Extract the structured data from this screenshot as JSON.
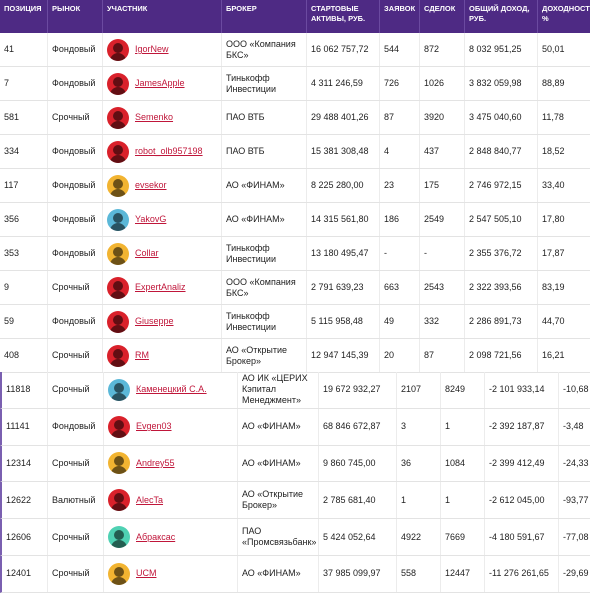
{
  "header": {
    "position": "ПОЗИЦИЯ",
    "market": "РЫНОК",
    "participant": "УЧАСТНИК",
    "broker": "БРОКЕР",
    "assets": "СТАРТОВЫЕ АКТИВЫ, РУБ.",
    "orders": "ЗАЯВОК",
    "deals": "СДЕЛОК",
    "income": "ОБЩИЙ ДОХОД, РУБ.",
    "yield": "ДОХОДНОСТЬ, %"
  },
  "top_rows": [
    {
      "pos": "41",
      "market": "Фондовый",
      "name": "IgorNew",
      "broker": "ООО «Компания БКС»",
      "assets": "16 062 757,72",
      "orders": "544",
      "deals": "872",
      "income": "8 032 951,25",
      "yield": "50,01",
      "avatar_color": "#d9212b"
    },
    {
      "pos": "7",
      "market": "Фондовый",
      "name": "JamesApple",
      "broker": "Тинькофф Инвестиции",
      "assets": "4 311 246,59",
      "orders": "726",
      "deals": "1026",
      "income": "3 832 059,98",
      "yield": "88,89",
      "avatar_color": "#d9212b"
    },
    {
      "pos": "581",
      "market": "Срочный",
      "name": "Semenko",
      "broker": "ПАО ВТБ",
      "assets": "29 488 401,26",
      "orders": "87",
      "deals": "3920",
      "income": "3 475 040,60",
      "yield": "11,78",
      "avatar_color": "#d9212b"
    },
    {
      "pos": "334",
      "market": "Фондовый",
      "name": "robot_olb957198",
      "broker": "ПАО ВТБ",
      "assets": "15 381 308,48",
      "orders": "4",
      "deals": "437",
      "income": "2 848 840,77",
      "yield": "18,52",
      "avatar_color": "#d9212b"
    },
    {
      "pos": "117",
      "market": "Фондовый",
      "name": "evsekor",
      "broker": "АО «ФИНАМ»",
      "assets": "8 225 280,00",
      "orders": "23",
      "deals": "175",
      "income": "2 746 972,15",
      "yield": "33,40",
      "avatar_color": "#f2b431"
    },
    {
      "pos": "356",
      "market": "Фондовый",
      "name": "YakovG",
      "broker": "АО «ФИНАМ»",
      "assets": "14 315 561,80",
      "orders": "186",
      "deals": "2549",
      "income": "2 547 505,10",
      "yield": "17,80",
      "avatar_color": "#5bb8d8"
    },
    {
      "pos": "353",
      "market": "Фондовый",
      "name": "Collar",
      "broker": "Тинькофф Инвестиции",
      "assets": "13 180 495,47",
      "orders": "-",
      "deals": "-",
      "income": "2 355 376,72",
      "yield": "17,87",
      "avatar_color": "#f2b431"
    },
    {
      "pos": "9",
      "market": "Срочный",
      "name": "ExpertAnaliz",
      "broker": "ООО «Компания БКС»",
      "assets": "2 791 639,23",
      "orders": "663",
      "deals": "2543",
      "income": "2 322 393,56",
      "yield": "83,19",
      "avatar_color": "#d9212b"
    },
    {
      "pos": "59",
      "market": "Фондовый",
      "name": "Giuseppe",
      "broker": "Тинькофф Инвестиции",
      "assets": "5 115 958,48",
      "orders": "49",
      "deals": "332",
      "income": "2 286 891,73",
      "yield": "44,70",
      "avatar_color": "#d9212b"
    },
    {
      "pos": "408",
      "market": "Срочный",
      "name": "RM",
      "broker": "АО «Открытие Брокер»",
      "assets": "12 947 145,39",
      "orders": "20",
      "deals": "87",
      "income": "2 098 721,56",
      "yield": "16,21",
      "avatar_color": "#d9212b"
    }
  ],
  "bottom_rows": [
    {
      "pos": "11818",
      "market": "Срочный",
      "name": "Каменецкий С.А.",
      "broker": "АО ИК «ЦЕРИХ Кэпитал Менеджмент»",
      "assets": "19 672 932,27",
      "orders": "2107",
      "deals": "8249",
      "income": "-2 101 933,14",
      "yield": "-10,68",
      "avatar_color": "#5bb8d8"
    },
    {
      "pos": "11141",
      "market": "Фондовый",
      "name": "Evgen03",
      "broker": "АО «ФИНАМ»",
      "assets": "68 846 672,87",
      "orders": "3",
      "deals": "1",
      "income": "-2 392 187,87",
      "yield": "-3,48",
      "avatar_color": "#d9212b"
    },
    {
      "pos": "12314",
      "market": "Срочный",
      "name": "Andrey55",
      "broker": "АО «ФИНАМ»",
      "assets": "9 860 745,00",
      "orders": "36",
      "deals": "1084",
      "income": "-2 399 412,49",
      "yield": "-24,33",
      "avatar_color": "#f2b431"
    },
    {
      "pos": "12622",
      "market": "Валютный",
      "name": "AlecTa",
      "broker": "АО «Открытие Брокер»",
      "assets": "2 785 681,40",
      "orders": "1",
      "deals": "1",
      "income": "-2 612 045,00",
      "yield": "-93,77",
      "avatar_color": "#d9212b"
    },
    {
      "pos": "12606",
      "market": "Срочный",
      "name": "Абраксас",
      "broker": "ПАО «Промсвязьбанк»",
      "assets": "5 424 052,64",
      "orders": "4922",
      "deals": "7669",
      "income": "-4 180 591,67",
      "yield": "-77,08",
      "avatar_color": "#4fd1b3"
    },
    {
      "pos": "12401",
      "market": "Срочный",
      "name": "UCM",
      "broker": "АО «ФИНАМ»",
      "assets": "37 985 099,97",
      "orders": "558",
      "deals": "12447",
      "income": "-11 276 261,65",
      "yield": "-29,69",
      "avatar_color": "#f2b431"
    }
  ]
}
